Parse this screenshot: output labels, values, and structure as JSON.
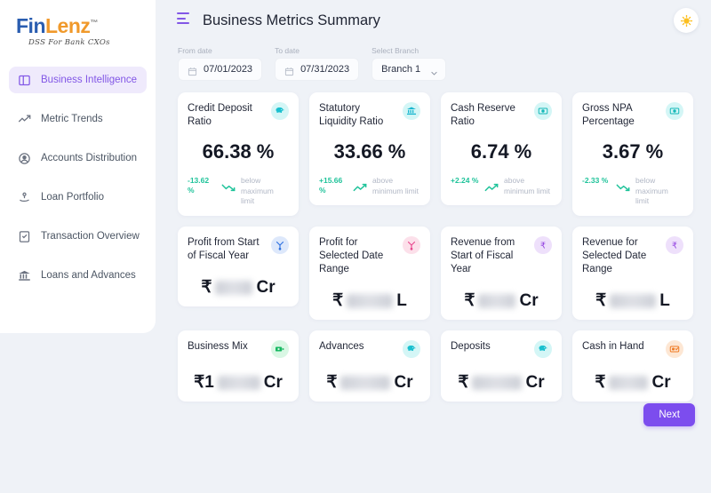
{
  "brand": {
    "name_part1": "Fin",
    "name_part2": "Lenz",
    "tm": "™",
    "tagline": "DSS For Bank CXOs"
  },
  "sidebar": {
    "items": [
      {
        "label": "Business Intelligence",
        "icon": "panel-icon",
        "active": true
      },
      {
        "label": "Metric Trends",
        "icon": "trend-icon",
        "active": false
      },
      {
        "label": "Accounts Distribution",
        "icon": "account-circle-icon",
        "active": false
      },
      {
        "label": "Loan Portfolio",
        "icon": "loan-hand-icon",
        "active": false
      },
      {
        "label": "Transaction Overview",
        "icon": "transaction-list-icon",
        "active": false
      },
      {
        "label": "Loans and Advances",
        "icon": "bank-building-icon",
        "active": false
      }
    ]
  },
  "header": {
    "title": "Business Metrics Summary",
    "menu_icon": "hamburger-icon",
    "theme_icon": "sun-icon"
  },
  "filters": {
    "from": {
      "label": "From date",
      "value": "07/01/2023",
      "icon": "calendar-icon"
    },
    "to": {
      "label": "To date",
      "value": "07/31/2023",
      "icon": "calendar-icon"
    },
    "branch": {
      "label": "Select Branch",
      "value": "Branch 1",
      "icon": "chevron-down-icon"
    }
  },
  "cards": {
    "row1": [
      {
        "title": "Credit Deposit Ratio",
        "value": "66.38 %",
        "delta": "-13.62 %",
        "delta_dir": "down",
        "note": "below maximum limit",
        "icon": "piggy-bank-icon",
        "icon_tone": "ic-cyan"
      },
      {
        "title": "Statutory Liquidity Ratio",
        "value": "33.66 %",
        "delta": "+15.66 %",
        "delta_dir": "up",
        "note": "above minimum limit",
        "icon": "bank-building-icon",
        "icon_tone": "ic-cyan"
      },
      {
        "title": "Cash Reserve Ratio",
        "value": "6.74 %",
        "delta": "+2.24 %",
        "delta_dir": "up",
        "note": "above minimum limit",
        "icon": "cash-note-icon",
        "icon_tone": "ic-cyan"
      },
      {
        "title": "Gross NPA Percentage",
        "value": "3.67 %",
        "delta": "-2.33 %",
        "delta_dir": "down",
        "note": "below maximum limit",
        "icon": "cash-note-icon",
        "icon_tone": "ic-cyan"
      }
    ],
    "row2": [
      {
        "title": "Profit from Start of Fiscal Year",
        "currency": "₹",
        "value_hidden": true,
        "unit": "Cr",
        "icon": "profit-funnel-icon",
        "icon_tone": "ic-blue"
      },
      {
        "title": "Profit for Selected Date Range",
        "currency": "₹",
        "value_hidden": true,
        "unit": "L",
        "icon": "profit-funnel-icon",
        "icon_tone": "ic-pink"
      },
      {
        "title": "Revenue from Start of Fiscal Year",
        "currency": "₹",
        "value_hidden": true,
        "unit": "Cr",
        "icon": "revenue-rupee-icon",
        "icon_tone": "ic-purple"
      },
      {
        "title": "Revenue for Selected Date Range",
        "currency": "₹",
        "value_hidden": true,
        "unit": "L",
        "icon": "revenue-rupee-icon",
        "icon_tone": "ic-purple"
      }
    ],
    "row3": [
      {
        "title": "Business Mix",
        "currency": "₹1",
        "value_hidden": true,
        "unit": "Cr",
        "icon": "business-money-icon",
        "icon_tone": "ic-green"
      },
      {
        "title": "Advances",
        "currency": "₹",
        "value_hidden": true,
        "unit": "Cr",
        "icon": "piggy-bank-icon",
        "icon_tone": "ic-cyan"
      },
      {
        "title": "Deposits",
        "currency": "₹",
        "value_hidden": true,
        "unit": "Cr",
        "icon": "piggy-bank-icon",
        "icon_tone": "ic-cyan"
      },
      {
        "title": "Cash in Hand",
        "currency": "₹",
        "value_hidden": true,
        "unit": "Cr",
        "icon": "wallet-icon",
        "icon_tone": "ic-orange"
      }
    ]
  },
  "footer": {
    "next_label": "Next"
  },
  "colors": {
    "accent_purple": "#7c4dee",
    "positive_green": "#1fc39a",
    "brand_blue": "#2a5db0",
    "brand_orange": "#f0992b"
  }
}
